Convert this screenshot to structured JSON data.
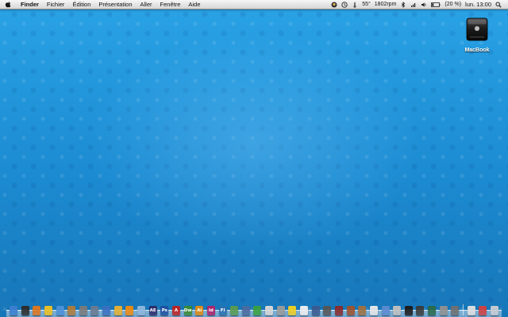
{
  "menubar": {
    "app_name": "Finder",
    "items": [
      "Fichier",
      "Édition",
      "Présentation",
      "Aller",
      "Fenêtre",
      "Aide"
    ],
    "status": {
      "temperature": "55°",
      "fan": "1802rpm",
      "battery": "(20 %)",
      "clock": "lun. 13:00"
    }
  },
  "desktop": {
    "drive_label": "MacBook"
  },
  "dock": {
    "apps": [
      {
        "name": "finder-icon",
        "color": "#3b7fd0",
        "glyph": ""
      },
      {
        "name": "dashboard-icon",
        "color": "#2b2b2b",
        "glyph": ""
      },
      {
        "name": "firefox-icon",
        "color": "#e0761d",
        "glyph": ""
      },
      {
        "name": "adium-icon",
        "color": "#f0c020",
        "glyph": ""
      },
      {
        "name": "finder-2-icon",
        "color": "#4a90d8",
        "glyph": ""
      },
      {
        "name": "photo-icon",
        "color": "#b07b3a",
        "glyph": ""
      },
      {
        "name": "utility-icon",
        "color": "#7a7a7a",
        "glyph": ""
      },
      {
        "name": "system-preferences-icon",
        "color": "#6a7a90",
        "glyph": ""
      },
      {
        "name": "itunes-icon",
        "color": "#3a6fc0",
        "glyph": ""
      },
      {
        "name": "pages-icon",
        "color": "#e8b030",
        "glyph": ""
      },
      {
        "name": "vlc-icon",
        "color": "#f08a10",
        "glyph": ""
      },
      {
        "name": "folder-icon",
        "color": "#8fb6dc",
        "glyph": ""
      },
      {
        "name": "after-effects-icon",
        "color": "#2a2a6a",
        "glyph": "AE"
      },
      {
        "name": "photoshop-icon",
        "color": "#1d4fa0",
        "glyph": "Ps"
      },
      {
        "name": "acrobat-icon",
        "color": "#c02020",
        "glyph": "A"
      },
      {
        "name": "dreamweaver-icon",
        "color": "#3a8a30",
        "glyph": "Dw"
      },
      {
        "name": "illustrator-icon",
        "color": "#e08a10",
        "glyph": "Ai"
      },
      {
        "name": "indesign-icon",
        "color": "#b0206a",
        "glyph": "Id"
      },
      {
        "name": "flash-icon",
        "color": "#2a70b0",
        "glyph": "Fl"
      },
      {
        "name": "preview-icon",
        "color": "#5a9a50",
        "glyph": ""
      },
      {
        "name": "xcode-icon",
        "color": "#4a6aa0",
        "glyph": ""
      },
      {
        "name": "games-icon",
        "color": "#3aa040",
        "glyph": ""
      },
      {
        "name": "stickies-icon",
        "color": "#d8d8d8",
        "glyph": ""
      },
      {
        "name": "chess-icon",
        "color": "#9a9a9a",
        "glyph": ""
      },
      {
        "name": "rubber-duck-icon",
        "color": "#f2d020",
        "glyph": ""
      },
      {
        "name": "text-edit-icon",
        "color": "#f0f0f0",
        "glyph": ""
      },
      {
        "name": "network-icon",
        "color": "#3a5a90",
        "glyph": ""
      },
      {
        "name": "calculator-icon",
        "color": "#555555",
        "glyph": ""
      },
      {
        "name": "photo-booth-icon",
        "color": "#8a2a2a",
        "glyph": ""
      },
      {
        "name": "coffee-icon",
        "color": "#a0522d",
        "glyph": ""
      },
      {
        "name": "address-book-icon",
        "color": "#a07040",
        "glyph": ""
      },
      {
        "name": "ical-icon",
        "color": "#e8e8e8",
        "glyph": ""
      },
      {
        "name": "mail-icon",
        "color": "#5a8ad0",
        "glyph": ""
      },
      {
        "name": "iphoto-icon",
        "color": "#c0c0c0",
        "glyph": ""
      },
      {
        "name": "terminal-icon",
        "color": "#1a1a1a",
        "glyph": ""
      },
      {
        "name": "activity-monitor-icon",
        "color": "#3a3a3a",
        "glyph": ""
      },
      {
        "name": "time-machine-icon",
        "color": "#2a6a4a",
        "glyph": ""
      },
      {
        "name": "disk-utility-icon",
        "color": "#909090",
        "glyph": ""
      },
      {
        "name": "settings-icon",
        "color": "#707070",
        "glyph": ""
      },
      {
        "name": "documents-stack-icon",
        "color": "#e0e0e0",
        "glyph": ""
      },
      {
        "name": "downloads-stack-icon",
        "color": "#d04040",
        "glyph": ""
      },
      {
        "name": "trash-icon",
        "color": "#c8ccd2",
        "glyph": ""
      }
    ]
  },
  "colors": {
    "wallpaper": "#1d8fd6",
    "menubar": "#e6e6e6"
  }
}
